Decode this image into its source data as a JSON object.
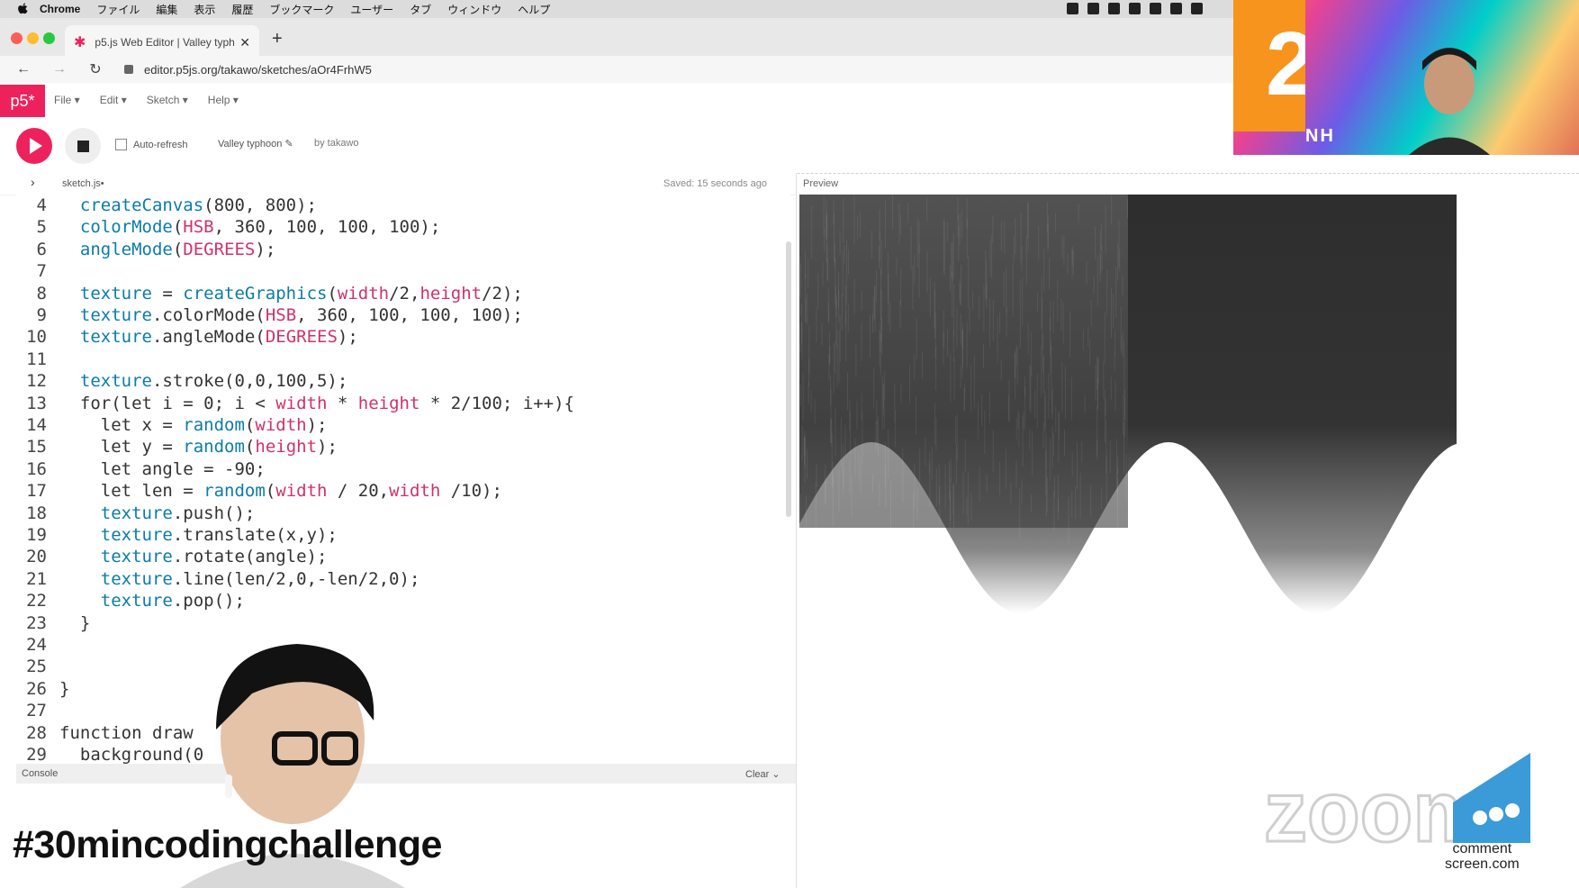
{
  "menubar": {
    "app": "Chrome",
    "items": [
      "ファイル",
      "編集",
      "表示",
      "履歴",
      "ブックマーク",
      "ユーザー",
      "タブ",
      "ウィンドウ",
      "ヘルプ"
    ]
  },
  "browser": {
    "tab_title": "p5.js Web Editor | Valley typh",
    "url": "editor.p5js.org/takawo/sketches/aOr4FrhW5"
  },
  "p5": {
    "logo": "p5*",
    "menu": [
      "File ▾",
      "Edit ▾",
      "Sketch ▾",
      "Help ▾"
    ],
    "auto_refresh_label": "Auto-refresh",
    "sketch_name": "Valley typhoon ✎",
    "byline": "by takawo",
    "file_name": "sketch.js•",
    "saved_status": "Saved: 15 seconds ago",
    "preview_label": "Preview",
    "console_label": "Console",
    "clear_label": "Clear"
  },
  "code_lines": [
    {
      "n": "4",
      "tokens": [
        {
          "t": "  "
        },
        {
          "t": "createCanvas",
          "c": "fn"
        },
        {
          "t": "(800, 800);"
        }
      ]
    },
    {
      "n": "5",
      "tokens": [
        {
          "t": "  "
        },
        {
          "t": "colorMode",
          "c": "fn"
        },
        {
          "t": "("
        },
        {
          "t": "HSB",
          "c": "pk"
        },
        {
          "t": ", 360, 100, 100, 100);"
        }
      ]
    },
    {
      "n": "6",
      "tokens": [
        {
          "t": "  "
        },
        {
          "t": "angleMode",
          "c": "fn"
        },
        {
          "t": "("
        },
        {
          "t": "DEGREES",
          "c": "pk"
        },
        {
          "t": ");"
        }
      ]
    },
    {
      "n": "7",
      "tokens": []
    },
    {
      "n": "8",
      "tokens": [
        {
          "t": "  "
        },
        {
          "t": "texture",
          "c": "fn"
        },
        {
          "t": " = "
        },
        {
          "t": "createGraphics",
          "c": "fn"
        },
        {
          "t": "("
        },
        {
          "t": "width",
          "c": "pk"
        },
        {
          "t": "/2,"
        },
        {
          "t": "height",
          "c": "pk"
        },
        {
          "t": "/2);"
        }
      ]
    },
    {
      "n": "9",
      "tokens": [
        {
          "t": "  "
        },
        {
          "t": "texture",
          "c": "fn"
        },
        {
          "t": ".colorMode("
        },
        {
          "t": "HSB",
          "c": "pk"
        },
        {
          "t": ", 360, 100, 100, 100);"
        }
      ]
    },
    {
      "n": "10",
      "tokens": [
        {
          "t": "  "
        },
        {
          "t": "texture",
          "c": "fn"
        },
        {
          "t": ".angleMode("
        },
        {
          "t": "DEGREES",
          "c": "pk"
        },
        {
          "t": ");"
        }
      ]
    },
    {
      "n": "11",
      "tokens": []
    },
    {
      "n": "12",
      "tokens": [
        {
          "t": "  "
        },
        {
          "t": "texture",
          "c": "fn"
        },
        {
          "t": ".stroke(0,0,100,5);"
        }
      ]
    },
    {
      "n": "13",
      "tokens": [
        {
          "t": "  for(let i = 0; i < "
        },
        {
          "t": "width",
          "c": "pk"
        },
        {
          "t": " * "
        },
        {
          "t": "height",
          "c": "pk"
        },
        {
          "t": " * 2/100; i++){"
        }
      ]
    },
    {
      "n": "14",
      "tokens": [
        {
          "t": "    let x = "
        },
        {
          "t": "random",
          "c": "fn"
        },
        {
          "t": "("
        },
        {
          "t": "width",
          "c": "pk"
        },
        {
          "t": ");"
        }
      ]
    },
    {
      "n": "15",
      "tokens": [
        {
          "t": "    let y = "
        },
        {
          "t": "random",
          "c": "fn"
        },
        {
          "t": "("
        },
        {
          "t": "height",
          "c": "pk"
        },
        {
          "t": ");"
        }
      ]
    },
    {
      "n": "16",
      "tokens": [
        {
          "t": "    let angle = -90;"
        }
      ]
    },
    {
      "n": "17",
      "tokens": [
        {
          "t": "    let len = "
        },
        {
          "t": "random",
          "c": "fn"
        },
        {
          "t": "("
        },
        {
          "t": "width",
          "c": "pk"
        },
        {
          "t": " / 20,"
        },
        {
          "t": "width",
          "c": "pk"
        },
        {
          "t": " /10);"
        }
      ]
    },
    {
      "n": "18",
      "tokens": [
        {
          "t": "    "
        },
        {
          "t": "texture",
          "c": "fn"
        },
        {
          "t": ".push();"
        }
      ]
    },
    {
      "n": "19",
      "tokens": [
        {
          "t": "    "
        },
        {
          "t": "texture",
          "c": "fn"
        },
        {
          "t": ".translate(x,y);"
        }
      ]
    },
    {
      "n": "20",
      "tokens": [
        {
          "t": "    "
        },
        {
          "t": "texture",
          "c": "fn"
        },
        {
          "t": ".rotate(angle);"
        }
      ]
    },
    {
      "n": "21",
      "tokens": [
        {
          "t": "    "
        },
        {
          "t": "texture",
          "c": "fn"
        },
        {
          "t": ".line(len/2,0,-len/2,0);"
        }
      ]
    },
    {
      "n": "22",
      "tokens": [
        {
          "t": "    "
        },
        {
          "t": "texture",
          "c": "fn"
        },
        {
          "t": ".pop();"
        }
      ]
    },
    {
      "n": "23",
      "tokens": [
        {
          "t": "  }"
        }
      ]
    },
    {
      "n": "24",
      "tokens": []
    },
    {
      "n": "25",
      "tokens": []
    },
    {
      "n": "26",
      "tokens": [
        {
          "t": "}"
        }
      ]
    },
    {
      "n": "27",
      "tokens": []
    },
    {
      "n": "28",
      "tokens": [
        {
          "t": "function draw"
        }
      ]
    },
    {
      "n": "29",
      "tokens": [
        {
          "t": "  background(0"
        }
      ]
    }
  ],
  "overlay": {
    "hashtag": "#30mincodingchallenge",
    "presenter_initials": "NH",
    "orange_digit": "2",
    "zoom_caption_1": "comment",
    "zoom_caption_2": "screen.com"
  },
  "colors": {
    "p5_accent": "#ed225d",
    "code_function": "#0b7ca9",
    "code_keyword": "#d0316b"
  }
}
